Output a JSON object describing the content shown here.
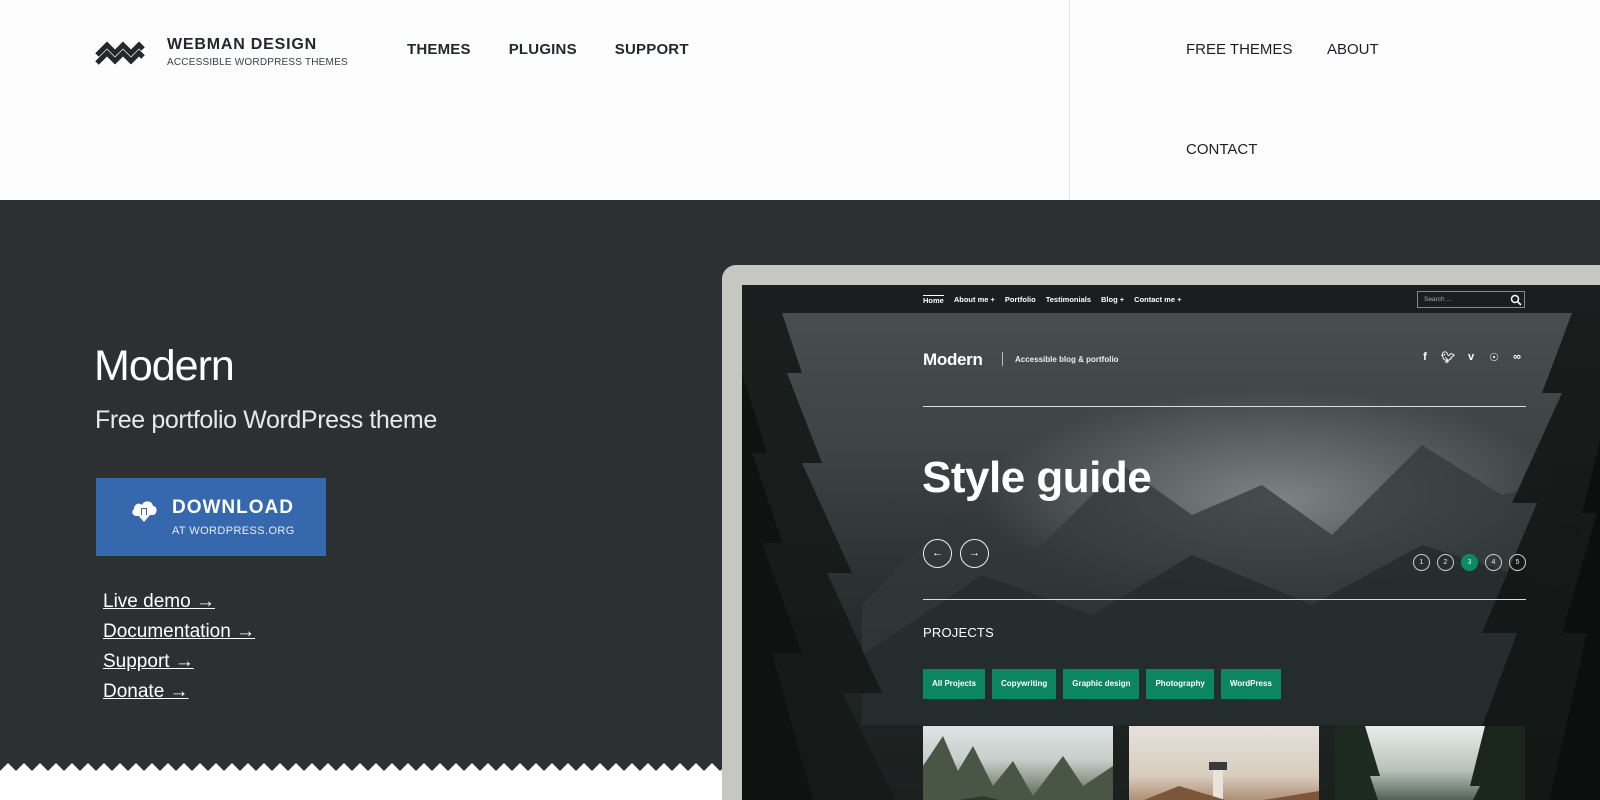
{
  "header": {
    "brand_name": "WEBMAN DESIGN",
    "brand_tagline": "ACCESSIBLE WORDPRESS THEMES",
    "main_nav": [
      "THEMES",
      "PLUGINS",
      "SUPPORT"
    ],
    "secondary_nav": [
      "FREE THEMES",
      "ABOUT",
      "CONTACT"
    ]
  },
  "hero": {
    "title": "Modern",
    "subtitle": "Free portfolio WordPress theme",
    "download_label": "DOWNLOAD",
    "download_sublabel": "AT WORDPRESS.ORG",
    "links": [
      "Live demo →",
      "Documentation →",
      "Support →",
      "Donate →"
    ],
    "background_color": "#2c3033",
    "button_color": "#3568ad"
  },
  "mockup": {
    "nav": [
      "Home",
      "About me +",
      "Portfolio",
      "Testimonials",
      "Blog +",
      "Contact me +"
    ],
    "search_placeholder": "Search ...",
    "brand": "Modern",
    "brand_tagline": "Accessible blog & portfolio",
    "social_icons": [
      "facebook-icon",
      "twitter-icon",
      "vimeo-icon",
      "wordpress-icon",
      "link-icon"
    ],
    "slide_title": "Style guide",
    "prev_label": "←",
    "next_label": "→",
    "slider_pages": [
      "1",
      "2",
      "3",
      "4",
      "5"
    ],
    "active_slide": "3",
    "projects_label": "PROJECTS",
    "filters": [
      "All Projects",
      "Copywriting",
      "Graphic design",
      "Photography",
      "WordPress"
    ],
    "accent_color": "#0b8660"
  }
}
